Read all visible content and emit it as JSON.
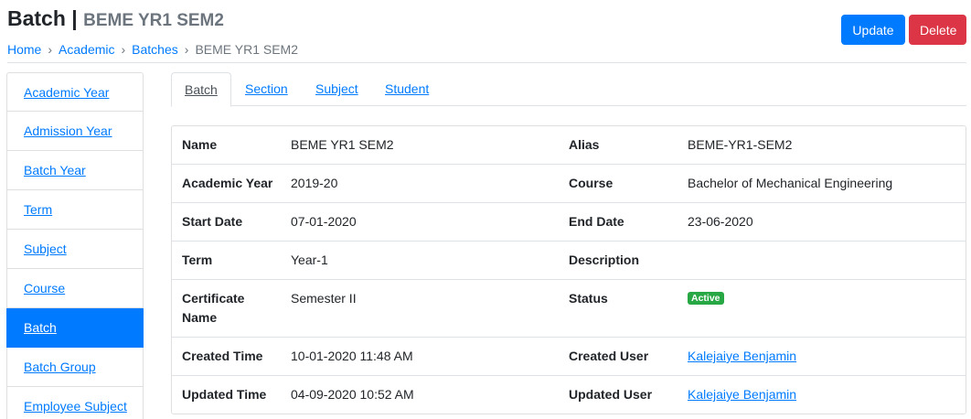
{
  "header": {
    "title": "Batch",
    "separator": "|",
    "subtitle": "BEME YR1 SEM2"
  },
  "breadcrumb": {
    "items": [
      "Home",
      "Academic",
      "Batches"
    ],
    "separator": "›",
    "current": "BEME YR1 SEM2"
  },
  "actions": {
    "update_label": "Update",
    "delete_label": "Delete"
  },
  "sidebar": {
    "items": [
      {
        "label": "Academic Year"
      },
      {
        "label": "Admission Year"
      },
      {
        "label": "Batch Year"
      },
      {
        "label": "Term"
      },
      {
        "label": "Subject"
      },
      {
        "label": "Course"
      },
      {
        "label": "Batch"
      },
      {
        "label": "Batch Group"
      },
      {
        "label": "Employee Subject"
      }
    ],
    "active": "Batch"
  },
  "tabs": [
    {
      "label": "Batch"
    },
    {
      "label": "Section"
    },
    {
      "label": "Subject"
    },
    {
      "label": "Student"
    }
  ],
  "details": {
    "rows": [
      [
        {
          "label": "Name",
          "value": "BEME YR1 SEM2"
        },
        {
          "label": "Alias",
          "value": "BEME-YR1-SEM2"
        }
      ],
      [
        {
          "label": "Academic Year",
          "value": "2019-20"
        },
        {
          "label": "Course",
          "value": "Bachelor of Mechanical Engineering"
        }
      ],
      [
        {
          "label": "Start Date",
          "value": "07-01-2020"
        },
        {
          "label": "End Date",
          "value": "23-06-2020"
        }
      ],
      [
        {
          "label": "Term",
          "value": "Year-1"
        },
        {
          "label": "Description",
          "value": ""
        }
      ],
      [
        {
          "label": "Certificate Name",
          "value": "Semester II"
        },
        {
          "label": "Status",
          "value": "Active"
        }
      ],
      [
        {
          "label": "Created Time",
          "value": "10-01-2020 11:48 AM"
        },
        {
          "label": "Created User",
          "value": "Kalejaiye Benjamin"
        }
      ],
      [
        {
          "label": "Updated Time",
          "value": "04-09-2020 10:52 AM"
        },
        {
          "label": "Updated User",
          "value": "Kalejaiye Benjamin"
        }
      ]
    ]
  },
  "colors": {
    "primary": "#007bff",
    "danger": "#dc3545",
    "success": "#28a745"
  }
}
